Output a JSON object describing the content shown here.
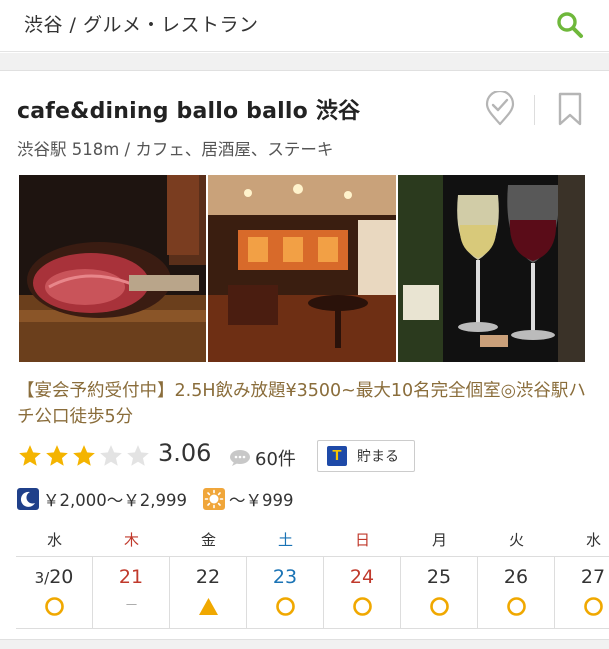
{
  "header": {
    "breadcrumb": "渋谷 / グルメ・レストラン",
    "search_icon": "search-icon"
  },
  "restaurant": {
    "name": "cafe&dining ballo ballo 渋谷",
    "meta": "渋谷駅 518m / カフェ、居酒屋、ステーキ",
    "photos": [
      "steak",
      "dining-room",
      "wine-glasses"
    ],
    "promo": "【宴会予約受付中】2.5H飲み放題¥3500~最大10名完全個室◎渋谷駅ハチ公口徒歩5分",
    "rating": 3.06,
    "rating_text": "3.06",
    "stars_filled": 3,
    "stars_total": 5,
    "reviews": "60件",
    "tpoint_label": "貯まる",
    "tpoint_logo": "T",
    "budget_night": "￥2,000～￥2,999",
    "budget_lunch": "～￥999"
  },
  "calendar": {
    "days": [
      {
        "weekday": "水",
        "date_prefix": "3/",
        "date": "20",
        "status": "open",
        "color": "#333333"
      },
      {
        "weekday": "木",
        "date_prefix": "",
        "date": "21",
        "status": "closed",
        "color": "#c0392b"
      },
      {
        "weekday": "金",
        "date_prefix": "",
        "date": "22",
        "status": "few",
        "color": "#333333"
      },
      {
        "weekday": "土",
        "date_prefix": "",
        "date": "23",
        "status": "open",
        "color": "#1a73b5"
      },
      {
        "weekday": "日",
        "date_prefix": "",
        "date": "24",
        "status": "open",
        "color": "#c0392b"
      },
      {
        "weekday": "月",
        "date_prefix": "",
        "date": "25",
        "status": "open",
        "color": "#333333"
      },
      {
        "weekday": "火",
        "date_prefix": "",
        "date": "26",
        "status": "open",
        "color": "#333333"
      },
      {
        "weekday": "水",
        "date_prefix": "",
        "date": "27",
        "status": "open",
        "color": "#333333"
      }
    ],
    "closed_mark": "－"
  },
  "colors": {
    "accent_green": "#6fb83b",
    "star": "#f4b400",
    "mark": "#f0a800",
    "promo_text": "#8a6d3b"
  }
}
